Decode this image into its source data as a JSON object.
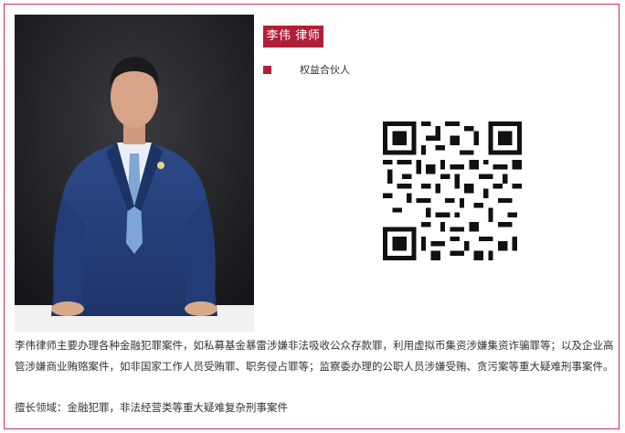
{
  "profile": {
    "name_badge": "李伟 律师",
    "title": "权益合伙人",
    "bio": "李伟律师主要办理各种金融犯罪案件，如私募基金暴雷涉嫌非法吸收公众存款罪，利用虚拟币集资涉嫌集资诈骗罪等；以及企业高管涉嫌商业贿赂案件，如非国家工作人员受贿罪、职务侵占罪等；监察委办理的公职人员涉嫌受贿、贪污案等重大疑难刑事案件。",
    "specialty": "擅长领域：金融犯罪，非法经营类等重大疑难复杂刑事案件"
  },
  "colors": {
    "accent": "#b01f3a",
    "border": "#c9324a",
    "text": "#333333"
  },
  "icons": {
    "qr": "qr-code-icon"
  }
}
